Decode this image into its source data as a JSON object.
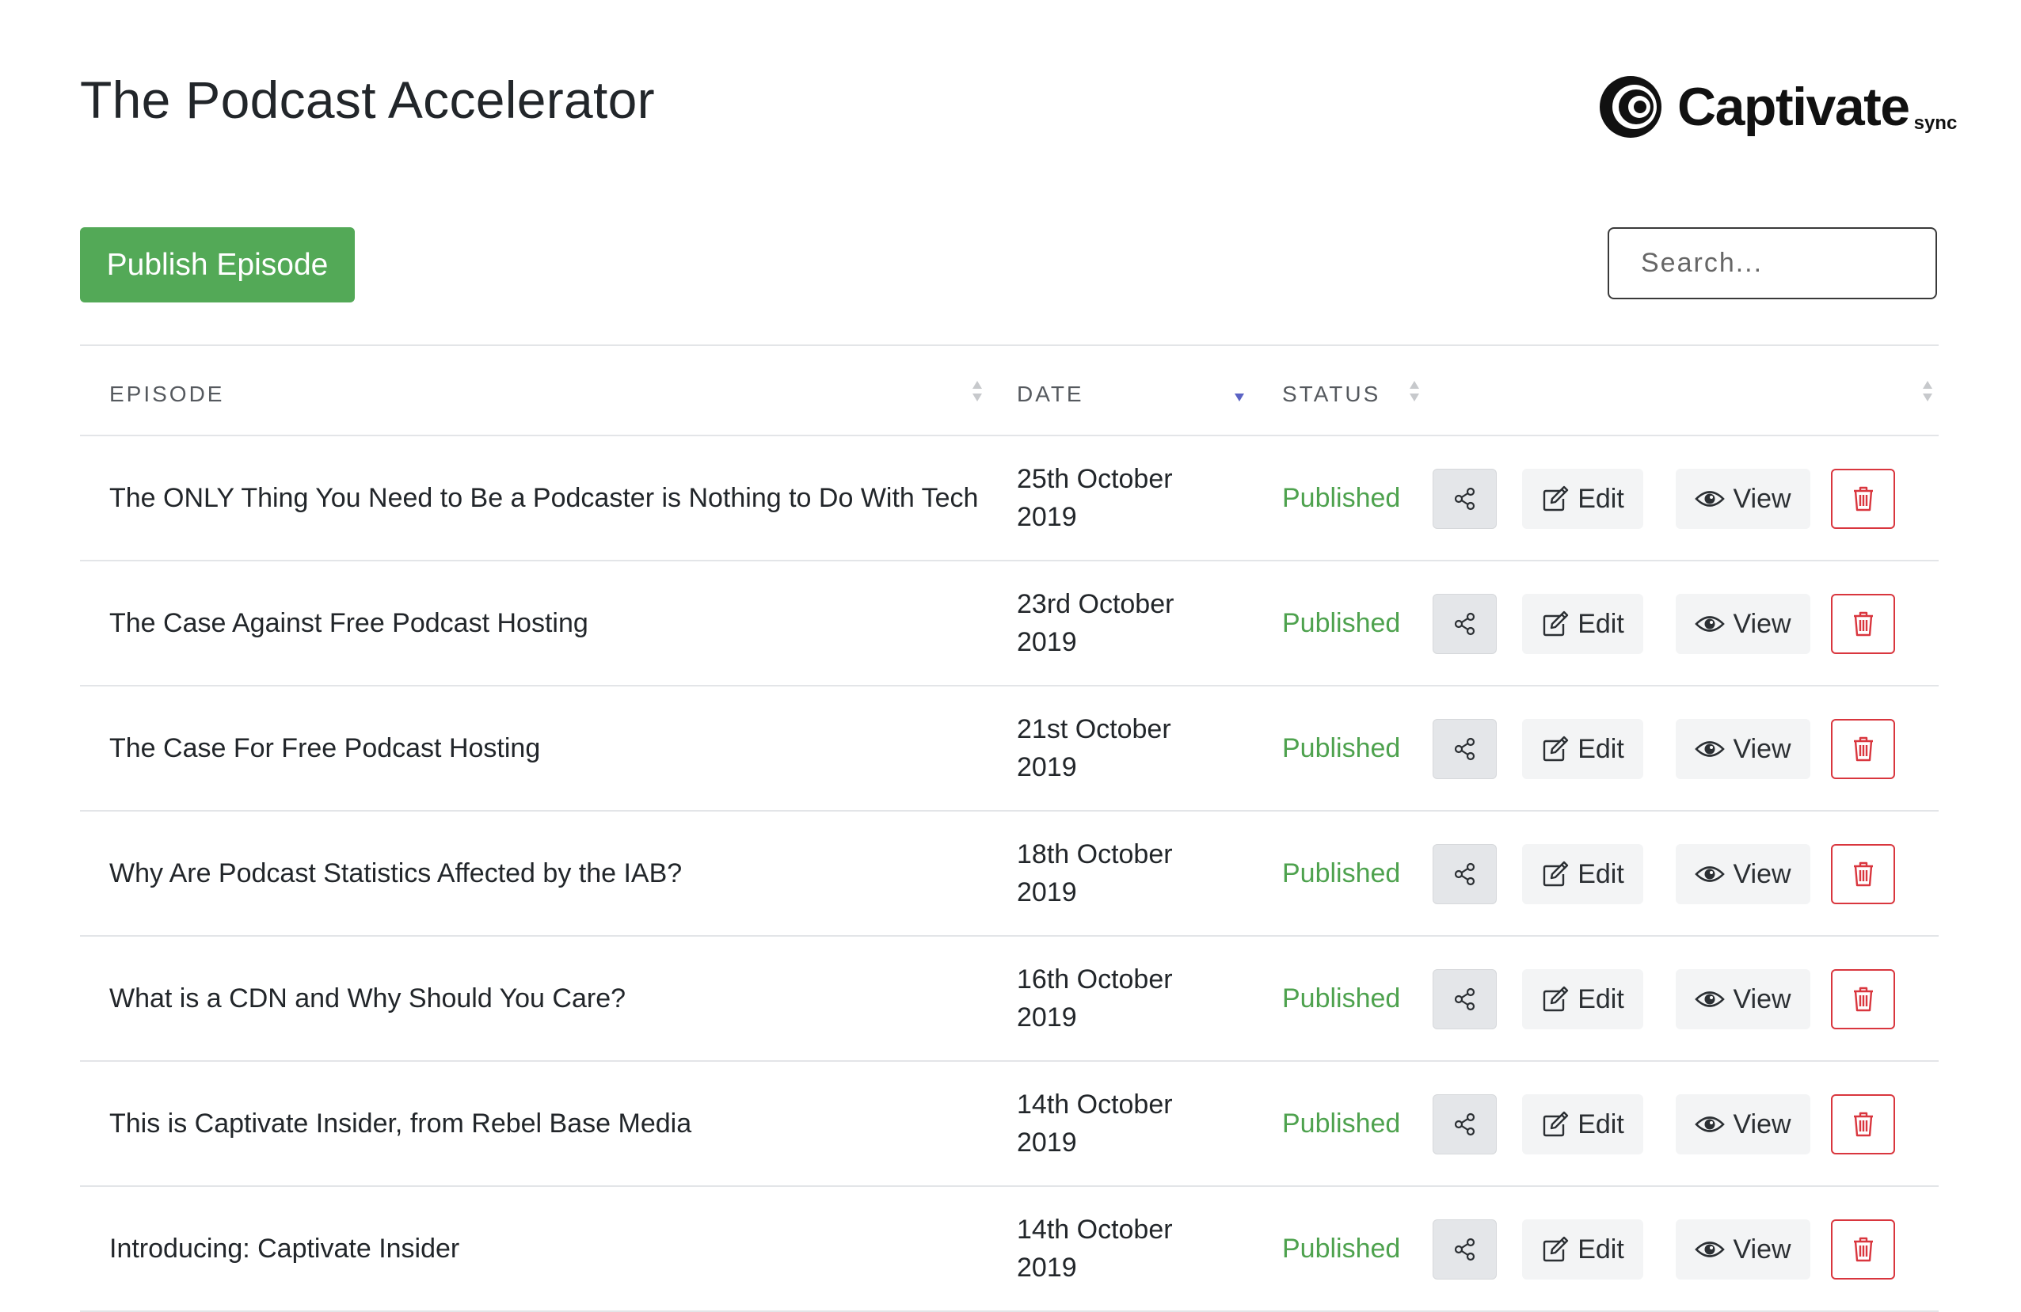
{
  "header": {
    "title": "The Podcast Accelerator",
    "logo_text": "Captivate",
    "logo_sub": "sync"
  },
  "toolbar": {
    "publish_label": "Publish Episode",
    "search_placeholder": "Search..."
  },
  "table": {
    "columns": {
      "episode": "EPISODE",
      "date": "DATE",
      "status": "STATUS"
    },
    "sorted_column": "date",
    "sort_direction": "descending",
    "action_labels": {
      "edit": "Edit",
      "view": "View"
    },
    "rows": [
      {
        "title": "The ONLY Thing You Need to Be a Podcaster is Nothing to Do With Tech",
        "date": "25th October 2019",
        "status": "Published"
      },
      {
        "title": "The Case Against Free Podcast Hosting",
        "date": "23rd October 2019",
        "status": "Published"
      },
      {
        "title": "The Case For Free Podcast Hosting",
        "date": "21st October 2019",
        "status": "Published"
      },
      {
        "title": "Why Are Podcast Statistics Affected by the IAB?",
        "date": "18th October 2019",
        "status": "Published"
      },
      {
        "title": "What is a CDN and Why Should You Care?",
        "date": "16th October 2019",
        "status": "Published"
      },
      {
        "title": "This is Captivate Insider, from Rebel Base Media",
        "date": "14th October 2019",
        "status": "Published"
      },
      {
        "title": "Introducing: Captivate Insider",
        "date": "14th October 2019",
        "status": "Published"
      }
    ]
  },
  "icons": {
    "share": "share-icon",
    "edit": "edit-icon",
    "view": "eye-icon",
    "delete": "trash-icon",
    "sort": "sort-icon"
  },
  "colors": {
    "publish_button": "#53a957",
    "status_published": "#4ea24e",
    "delete_border": "#d9363e",
    "sort_active": "#5b63c4"
  }
}
